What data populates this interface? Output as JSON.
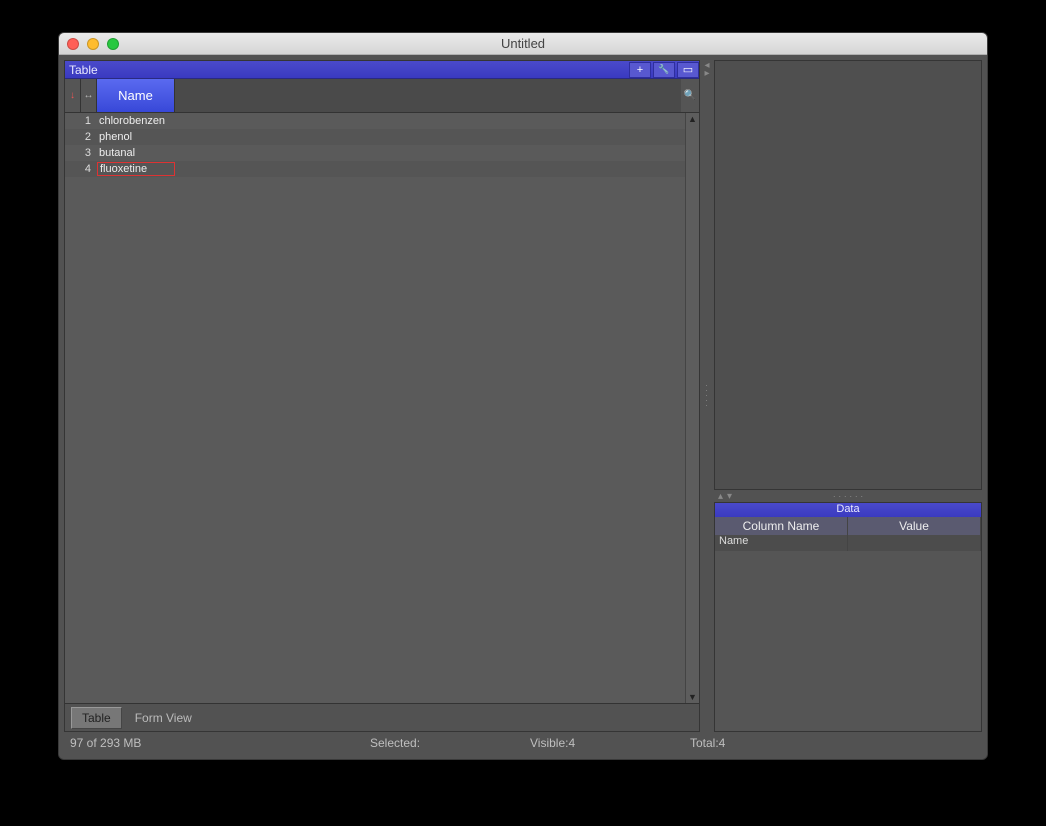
{
  "window": {
    "title": "Untitled"
  },
  "panel": {
    "title": "Table",
    "column_header": "Name",
    "rows": [
      {
        "num": "1",
        "name": "chlorobenzen",
        "selected": false
      },
      {
        "num": "2",
        "name": "phenol",
        "selected": false
      },
      {
        "num": "3",
        "name": "butanal",
        "selected": false
      },
      {
        "num": "4",
        "name": "fluoxetine",
        "selected": true
      }
    ],
    "tabs": {
      "table": "Table",
      "form": "Form View"
    }
  },
  "data_panel": {
    "title": "Data",
    "col1": "Column Name",
    "col2": "Value",
    "rows": [
      {
        "name": "Name",
        "value": ""
      }
    ]
  },
  "status": {
    "memory": "97 of 293 MB",
    "selected_label": "Selected:",
    "visible": "Visible:4",
    "total": "Total:4"
  },
  "icons": {
    "plus": "+",
    "wrench": "🔧",
    "window": "▭",
    "search": "🔍",
    "sort_down": "↓",
    "resize_h": "↔"
  }
}
